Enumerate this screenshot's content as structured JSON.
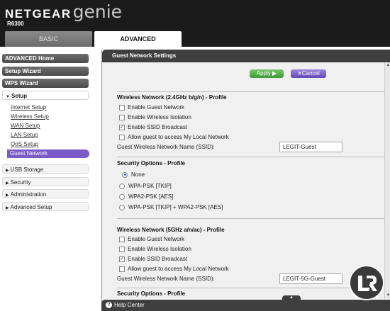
{
  "header": {
    "brand": "NETGEAR",
    "product": "genie",
    "model": "R6300",
    "tabs": {
      "basic": "BASIC",
      "advanced": "ADVANCED"
    }
  },
  "sidebar": {
    "advanced_home": "ADVANCED Home",
    "setup_wizard": "Setup Wizard",
    "wps_wizard": "WPS Wizard",
    "setup": "Setup",
    "setup_items": [
      "Internet Setup",
      "Wireless Setup",
      "WAN Setup",
      "LAN Setup",
      "QoS Setup",
      "Guest Network"
    ],
    "usb_storage": "USB Storage",
    "security": "Security",
    "administration": "Administration",
    "advanced_setup": "Advanced Setup"
  },
  "panel": {
    "title": "Guest Network Settings",
    "apply": "Apply",
    "cancel": "Cancel",
    "net24": {
      "title": "Wireless Network (2.4GHz b/g/n) - Profile",
      "enable_guest": "Enable Guest Network",
      "enable_isolation": "Enable Wireless Isolation",
      "enable_ssid": "Enable SSID Broadcast",
      "allow_local": "Allow guest to access My Local Network",
      "ssid_label": "Guest Wireless Network Name (SSID):",
      "ssid_value": "LEGIT-Guest"
    },
    "sec24": {
      "title": "Security Options - Profile",
      "none": "None",
      "wpa_tkip": "WPA-PSK [TKIP]",
      "wpa2_aes": "WPA2-PSK [AES]",
      "mixed": "WPA-PSK [TKIP] + WPA2-PSK [AES]"
    },
    "net5": {
      "title": "Wireless Network (5GHz a/n/ac) - Profile",
      "enable_guest": "Enable Guest Network",
      "enable_isolation": "Enable Wireless Isolation",
      "enable_ssid": "Enable SSID Broadcast",
      "allow_local": "Allow guest to access My Local Network",
      "ssid_label": "Guest Wireless Network Name (SSID):",
      "ssid_value": "LEGIT-5G-Guest"
    },
    "sec5": {
      "title": "Security Options - Profile"
    }
  },
  "help": {
    "label": "Help Center"
  },
  "icons": {
    "apply": "arrow-right-icon",
    "cancel": "x-icon",
    "help": "question-icon",
    "scroll_up": "triangle-up-icon",
    "scroll_down": "triangle-down-icon",
    "watermark": "legit-reviews-logo"
  },
  "colors": {
    "accent": "#7a5bc7",
    "apply": "#4aa83c",
    "cancel": "#6a4fc0",
    "header": "#1b1b1b"
  }
}
